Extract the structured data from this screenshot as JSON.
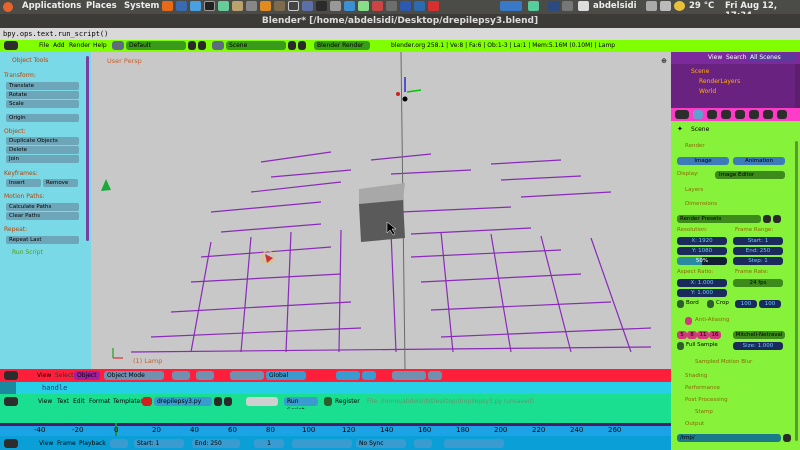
{
  "system_panel": {
    "applications": "Applications",
    "places": "Places",
    "system": "System",
    "username": "abdelsidi",
    "temperature": "29 °C",
    "datetime": "Fri Aug 12, 17:34"
  },
  "window": {
    "title": "Blender* [/home/abdelsidi/Desktop/drepilepsy3.blend]"
  },
  "script_line": "bpy.ops.text.run_script()",
  "info_header": {
    "menus": [
      "File",
      "Add",
      "Render",
      "Help"
    ],
    "layout": "Default",
    "scene": "Scene",
    "engine": "Blender Render",
    "stats": "blender.org 258.1 | Ve:8 | Fa:6 | Ob:1-3 | La:1 | Mem:5.16M (0.10M) | Lamp"
  },
  "tool_shelf": {
    "title": "Object Tools",
    "sections": {
      "transform": "Transform:",
      "object": "Object:",
      "keyframes": "Keyframes:",
      "motion_paths": "Motion Paths:",
      "repeat": "Repeat:"
    },
    "buttons": {
      "translate": "Translate",
      "rotate": "Rotate",
      "scale": "Scale",
      "origin": "Origin",
      "duplicate": "Duplicate Objects",
      "delete": "Delete",
      "join": "Join",
      "insert": "Insert",
      "remove": "Remove",
      "calc_paths": "Calculate Paths",
      "clear_paths": "Clear Paths",
      "repeat_last": "Repeat Last"
    },
    "operator_panel": "Run Script"
  },
  "viewport": {
    "label": "User Persp",
    "object_label": "(1) Lamp"
  },
  "view3d_header": {
    "menus": [
      "View",
      "Select",
      "Object"
    ],
    "mode": "Object Mode",
    "orientation": "Global"
  },
  "text_editor": {
    "top_label": "handle",
    "menus": [
      "View",
      "Text",
      "Edit",
      "Format",
      "Templates"
    ],
    "filename": "drepilepsy3.py",
    "run_script": "Run Script",
    "register": "Register",
    "file_info": "File: /home/abdelsidi/Desktop/drepilepsy3.py (unsaved)"
  },
  "timeline": {
    "ticks": [
      "-40",
      "-20",
      "0",
      "20",
      "40",
      "60",
      "80",
      "100",
      "120",
      "140",
      "160",
      "180",
      "200",
      "220",
      "240",
      "260"
    ],
    "menus": [
      "View",
      "Frame",
      "Playback"
    ],
    "start": "Start: 1",
    "end": "End: 250",
    "current": "1",
    "sync": "No Sync"
  },
  "outliner": {
    "menus": [
      "View",
      "Search",
      "All Scenes"
    ],
    "items": [
      "Scene",
      "RenderLayers",
      "World"
    ]
  },
  "properties": {
    "scene_name": "Scene",
    "render_label": "Render",
    "image_btn": "Image",
    "animation_btn": "Animation",
    "display_label": "Display:",
    "display_value": "Image Editor",
    "layers_label": "Layers",
    "dimensions_label": "Dimensions",
    "presets": "Render Presets",
    "resolution_label": "Resolution:",
    "frame_range_label": "Frame Range:",
    "res_x": "X: 1920",
    "res_y": "Y: 1080",
    "res_pct": "50%",
    "start_frame": "Start: 1",
    "end_frame": "End: 250",
    "step": "Step: 1",
    "aspect_label": "Aspect Ratio:",
    "frame_rate_label": "Frame Rate:",
    "aspect_x": "X: 1.000",
    "aspect_y": "Y: 1.000",
    "fps": "24 fps",
    "border": "Bord",
    "crop": "Crop",
    "time_old": "100",
    "time_new": "100",
    "antialiasing": "Anti-Aliasing",
    "aa_samples": [
      "5",
      "8",
      "11",
      "16"
    ],
    "filter": "Mitchell-Netraval",
    "full_sample": "Full Sample",
    "size": "Size: 1.000",
    "sampled_motion_blur": "Sampled Motion Blur",
    "shading": "Shading",
    "performance": "Performance",
    "post_processing": "Post Processing",
    "stamp": "Stamp",
    "output": "Output",
    "output_path": "/tmp/"
  }
}
